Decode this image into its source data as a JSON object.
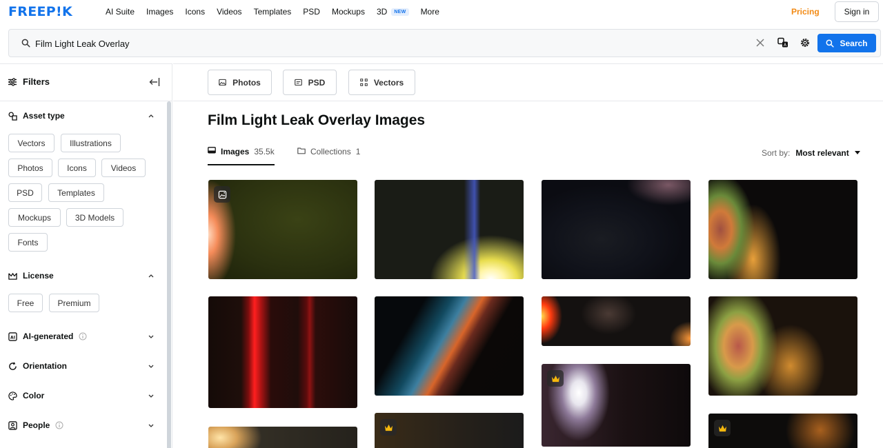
{
  "nav": {
    "logo": "FREEP!K",
    "links": [
      "AI Suite",
      "Images",
      "Icons",
      "Videos",
      "Templates",
      "PSD",
      "Mockups",
      "3D",
      "More"
    ],
    "new_badge": "NEW",
    "pricing": "Pricing",
    "sign_in": "Sign in"
  },
  "search": {
    "value": "Film Light Leak Overlay",
    "button_label": "Search"
  },
  "sidebar": {
    "filters_title": "Filters",
    "asset_type": {
      "title": "Asset type",
      "chips": [
        "Vectors",
        "Illustrations",
        "Photos",
        "Icons",
        "Videos",
        "PSD",
        "Templates",
        "Mockups",
        "3D Models",
        "Fonts"
      ]
    },
    "license": {
      "title": "License",
      "chips": [
        "Free",
        "Premium"
      ]
    },
    "ai_generated": "AI-generated",
    "orientation": "Orientation",
    "color": "Color",
    "people": "People"
  },
  "main": {
    "type_buttons": [
      "Photos",
      "PSD",
      "Vectors"
    ],
    "title": "Film Light Leak Overlay Images",
    "tabs": [
      {
        "label": "Images",
        "count": "35.5k"
      },
      {
        "label": "Collections",
        "count": "1"
      }
    ],
    "sort_label": "Sort by:",
    "sort_value": "Most relevant"
  },
  "colors": {
    "brand_blue": "#1273eb",
    "pricing_orange": "#f28a14",
    "premium_gold": "#f5b70d"
  }
}
